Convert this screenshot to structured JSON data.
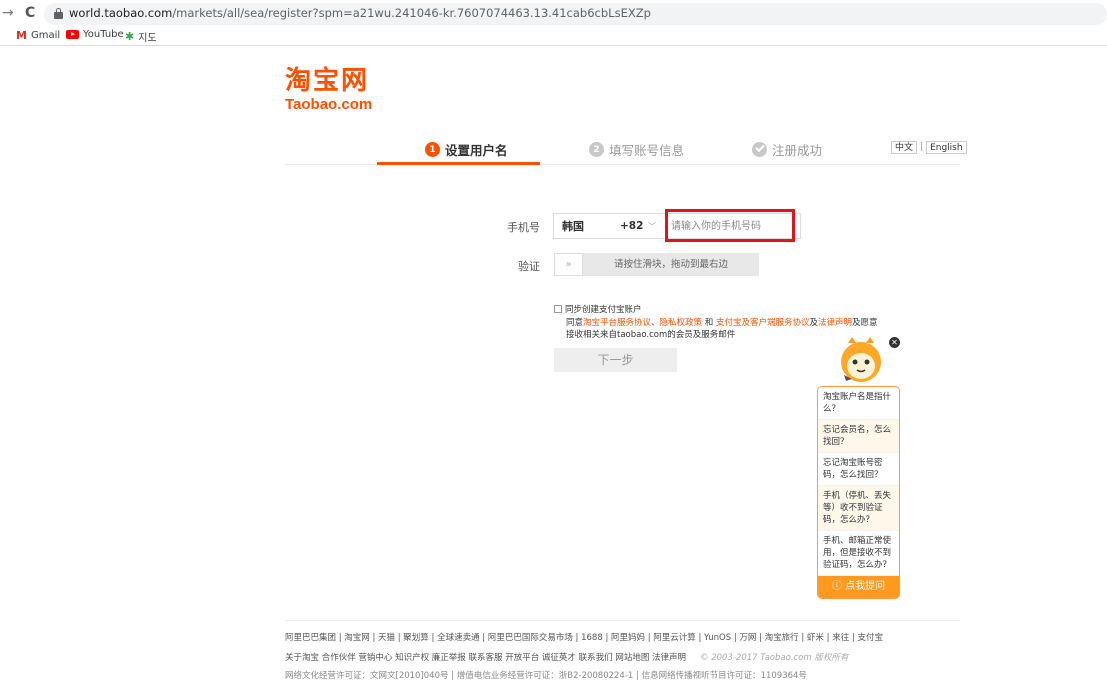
{
  "browser": {
    "url_host": "world.taobao.com",
    "url_path": "/markets/all/sea/register?spm=a21wu.241046-kr.7607074463.13.41cab6cbLsEXZp",
    "bookmarks": [
      "Gmail",
      "YouTube",
      "지도"
    ]
  },
  "logo": {
    "cn": "淘宝网",
    "en": "Taobao.com"
  },
  "steps": [
    {
      "num": "1",
      "label": "设置用户名"
    },
    {
      "num": "2",
      "label": "填写账号信息"
    },
    {
      "label": "注册成功"
    }
  ],
  "lang": {
    "zh": "中文",
    "en": "English"
  },
  "form": {
    "phone_label": "手机号",
    "country": "韩国",
    "code": "+82",
    "phone_placeholder": "请输入你的手机号码",
    "verify_label": "验证",
    "slider_text": "请按住滑块，拖动到最右边",
    "agree_line1": "同步创建支付宝账户",
    "agree_prefix": "同意",
    "link1": "淘宝平台服务协议",
    "sep1": "、",
    "link2": "隐私权政策",
    "and": " 和 ",
    "link3": "支付宝及客户端服务协议",
    "sep2": "及",
    "link4": "法律声明",
    "agree_suffix": "及愿意",
    "agree_line3": "接收相关来自taobao.com的会员及服务邮件",
    "next": "下一步"
  },
  "help": {
    "items": [
      "淘宝账户名是指什么？",
      "忘记会员名，怎么找回？",
      "忘记淘宝账号密码，怎么找回？",
      "手机（停机、丢失等）收不到验证码，怎么办？",
      "手机、邮箱正常使用，但是接收不到验证码，怎么办？"
    ],
    "ask": "点我提问"
  },
  "footer": {
    "row1": "阿里巴巴集团 | 淘宝网 | 天猫 | 聚划算 | 全球速卖通 | 阿里巴巴国际交易市场 | 1688 | 阿里妈妈 | 阿里云计算 | YunOS | 万网 | 淘宝旅行 | 虾米 | 来往 | 支付宝",
    "row2": "关于淘宝  合作伙伴  营销中心  知识产权  廉正举报  联系客服  开放平台  诚征英才  联系我们  网站地图  法律声明",
    "copyright": "© 2003-2017 Taobao.com 版权所有",
    "row3": "网络文化经营许可证：文网文[2010]040号 | 增值电信业务经营许可证：浙B2-20080224-1 | 信息网络传播视听节目许可证：1109364号"
  }
}
